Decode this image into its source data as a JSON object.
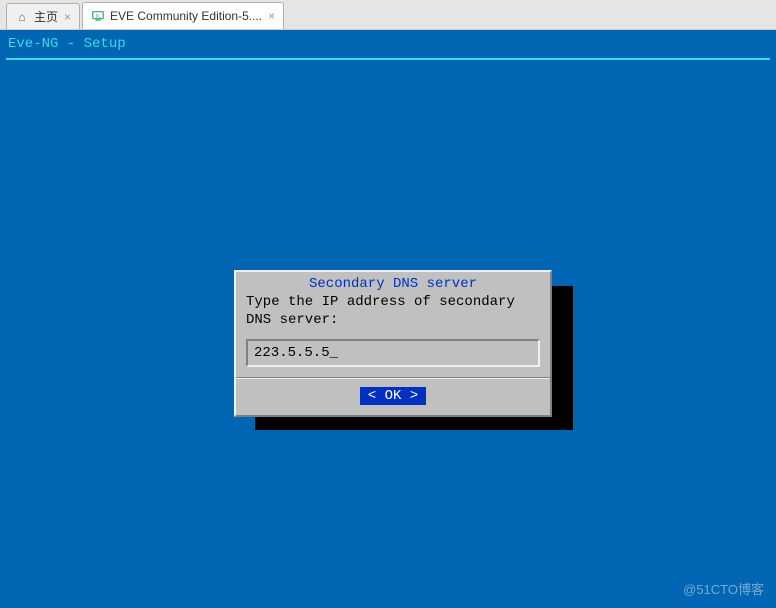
{
  "tabs": [
    {
      "label": "主页",
      "icon": "home"
    },
    {
      "label": "EVE Community Edition-5....",
      "icon": "vm"
    }
  ],
  "console": {
    "title": "Eve-NG - Setup"
  },
  "dialog": {
    "title": "Secondary DNS server",
    "prompt": "Type the IP address of secondary DNS server:",
    "input_value": "223.5.5.5_",
    "ok_label": "<  OK  >"
  },
  "watermark": "@51CTO博客"
}
